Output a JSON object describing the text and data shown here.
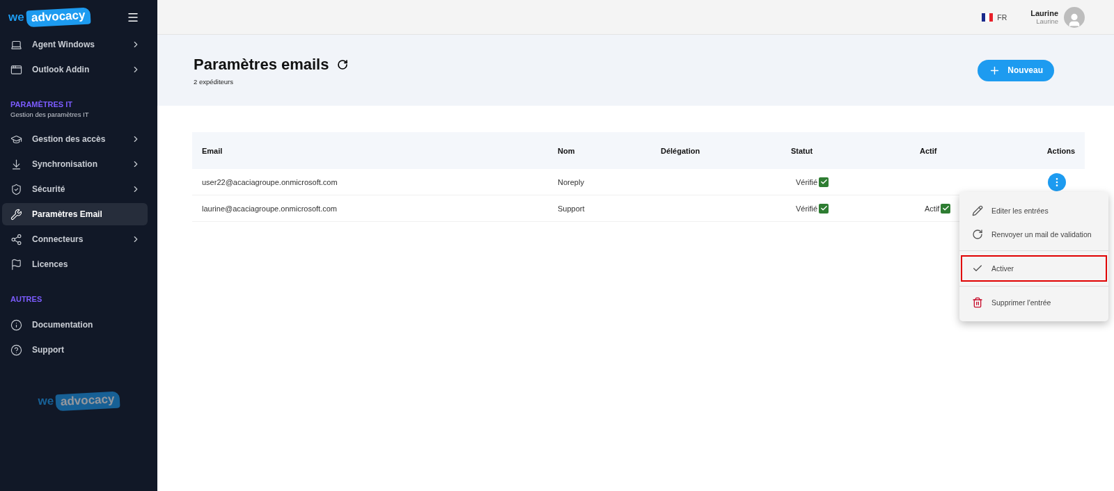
{
  "sidebar": {
    "logo": {
      "prefix": "we",
      "badge": "advocacy"
    },
    "sections": [
      {
        "items": [
          {
            "label": "Agent Windows",
            "has_children": true,
            "selected": false
          },
          {
            "label": "Outlook Addin",
            "has_children": true,
            "selected": false
          }
        ]
      },
      {
        "title": "PARAMÈTRES IT",
        "subtitle": "Gestion des paramètres IT",
        "items": [
          {
            "label": "Gestion des accès",
            "has_children": true,
            "selected": false
          },
          {
            "label": "Synchronisation",
            "has_children": true,
            "selected": false
          },
          {
            "label": "Sécurité",
            "has_children": true,
            "selected": false
          },
          {
            "label": "Paramètres Email",
            "has_children": false,
            "selected": true
          },
          {
            "label": "Connecteurs",
            "has_children": true,
            "selected": false
          },
          {
            "label": "Licences",
            "has_children": false,
            "selected": false
          }
        ]
      },
      {
        "title": "AUTRES",
        "items": [
          {
            "label": "Documentation",
            "has_children": false,
            "selected": false
          },
          {
            "label": "Support",
            "has_children": false,
            "selected": false
          }
        ]
      }
    ],
    "footer_logo": {
      "prefix": "we",
      "badge": "advocacy"
    }
  },
  "topbar": {
    "language": "FR",
    "user": {
      "name": "Laurine",
      "subtitle": "Laurine"
    }
  },
  "header": {
    "title": "Paramètres emails",
    "subtitle": "2 expéditeurs",
    "new_button": "Nouveau"
  },
  "table": {
    "columns": [
      "Email",
      "Nom",
      "Délégation",
      "Statut",
      "Actif",
      "Actions"
    ],
    "rows": [
      {
        "email": "user22@acaciagroupe.onmicrosoft.com",
        "name": "Noreply",
        "status": "Vérifié",
        "verified": true,
        "active_label": "",
        "active": false,
        "actions_button": true
      },
      {
        "email": "laurine@acaciagroupe.onmicrosoft.com",
        "name": "Support",
        "status": "Vérifié",
        "verified": true,
        "active_label": "Actif",
        "active": true,
        "actions_button": false
      }
    ]
  },
  "action_menu": {
    "items": [
      {
        "kind": "edit",
        "label": "Editer les entrées",
        "highlighted": false
      },
      {
        "kind": "resend",
        "label": "Renvoyer un mail de validation",
        "highlighted": false
      },
      {
        "kind": "activate",
        "label": "Activer",
        "highlighted": true
      },
      {
        "kind": "delete",
        "label": "Supprimer l'entrée",
        "highlighted": false
      }
    ]
  }
}
